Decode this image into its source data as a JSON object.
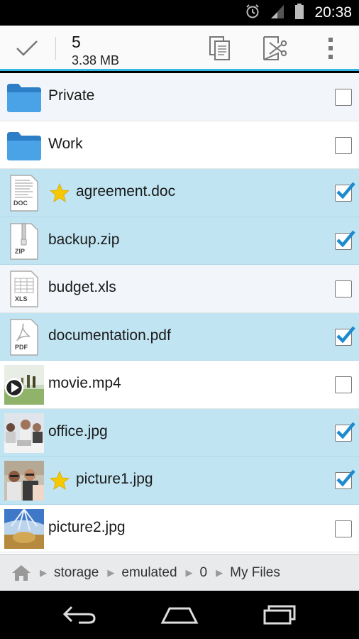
{
  "status_bar": {
    "time": "20:38",
    "icons": [
      "alarm-icon",
      "signal-icon",
      "battery-icon"
    ]
  },
  "action_bar": {
    "selected_count": "5",
    "selected_size": "3.38 MB",
    "buttons": [
      "done-check-icon",
      "copy-icon",
      "cut-icon",
      "overflow-menu-icon"
    ]
  },
  "files": [
    {
      "name": "Private",
      "type": "folder",
      "starred": false,
      "checked": false
    },
    {
      "name": "Work",
      "type": "folder",
      "starred": false,
      "checked": false
    },
    {
      "name": "agreement.doc",
      "type": "doc",
      "badge": "DOC",
      "starred": true,
      "checked": true
    },
    {
      "name": "backup.zip",
      "type": "zip",
      "badge": "ZIP",
      "starred": false,
      "checked": true
    },
    {
      "name": "budget.xls",
      "type": "xls",
      "badge": "XLS",
      "starred": false,
      "checked": false
    },
    {
      "name": "documentation.pdf",
      "type": "pdf",
      "badge": "PDF",
      "starred": false,
      "checked": true
    },
    {
      "name": "movie.mp4",
      "type": "video",
      "starred": false,
      "checked": false
    },
    {
      "name": "office.jpg",
      "type": "image",
      "starred": false,
      "checked": true
    },
    {
      "name": "picture1.jpg",
      "type": "image",
      "starred": true,
      "checked": true
    },
    {
      "name": "picture2.jpg",
      "type": "image",
      "starred": false,
      "checked": false
    }
  ],
  "breadcrumb": {
    "items": [
      "storage",
      "emulated",
      "0",
      "My Files"
    ]
  },
  "nav_bar": {
    "buttons": [
      "back-icon",
      "home-icon",
      "recents-icon"
    ]
  },
  "colors": {
    "accent": "#33b5e5",
    "selected_row": "#c0e4f2",
    "check_blue": "#1c8bd0",
    "star": "#f5c800",
    "folder": "#3a93d9"
  }
}
